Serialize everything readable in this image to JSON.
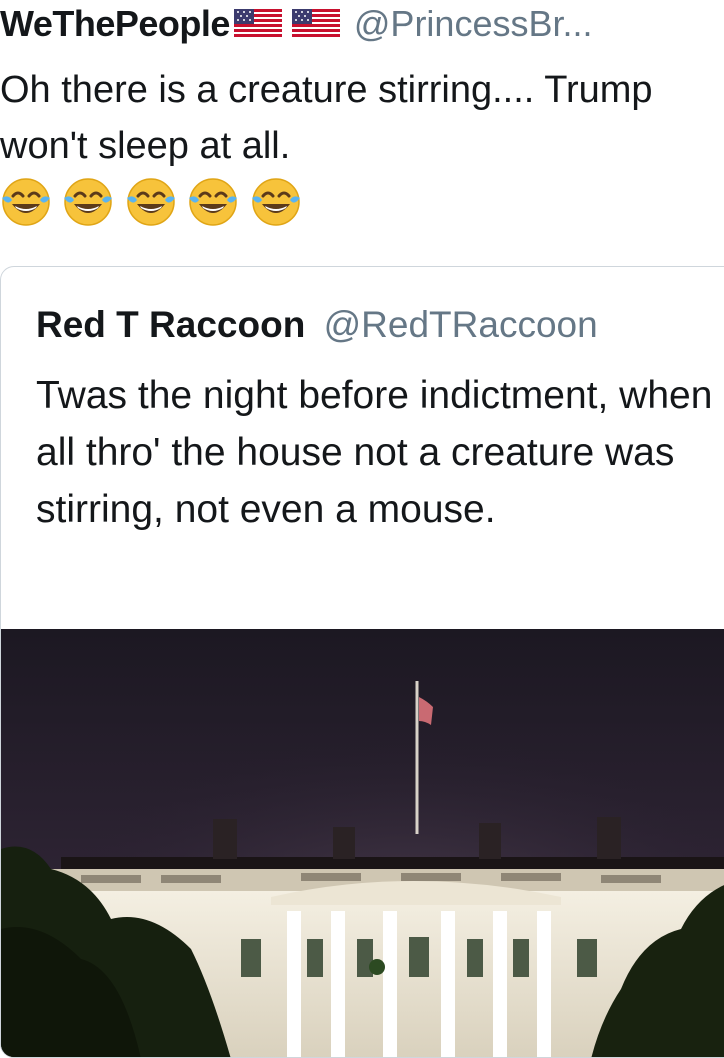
{
  "tweet": {
    "display_name": "WeThePeople",
    "handle": "@PrincessBr...",
    "text": "Oh there is a creature stirring.... Trump won't sleep at all.",
    "emoji": [
      "face-with-tears-of-joy",
      "face-with-tears-of-joy",
      "face-with-tears-of-joy",
      "face-with-tears-of-joy",
      "face-with-tears-of-joy"
    ]
  },
  "quoted_tweet": {
    "display_name": "Red T Raccoon",
    "handle": "@RedTRaccoon",
    "text": "Twas the night before indictment, when all thro' the house not a creature was stirring, not even a mouse.",
    "media": "white-house-at-night-photo"
  },
  "colors": {
    "text": "#14171a",
    "secondary": "#657786",
    "border": "#cfd6dc",
    "night_sky": "#2a2030"
  }
}
